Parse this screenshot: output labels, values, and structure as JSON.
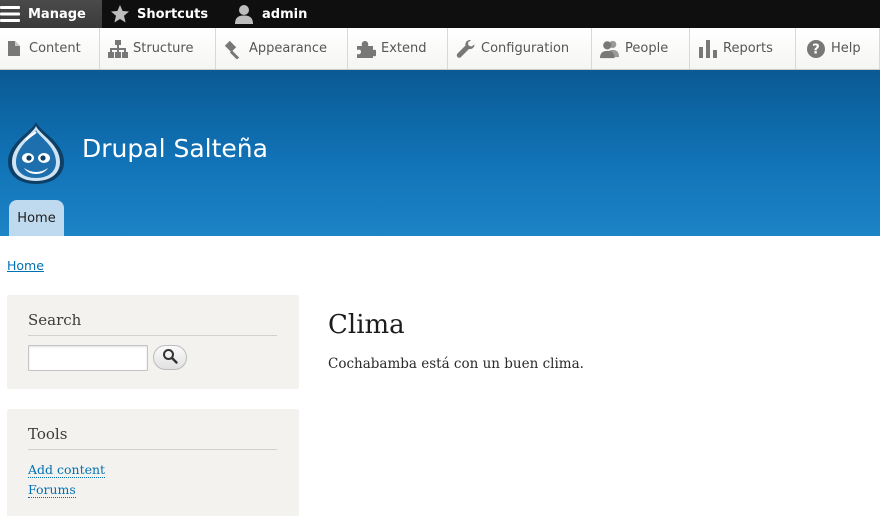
{
  "toolbar": {
    "manage": "Manage",
    "shortcuts": "Shortcuts",
    "user": "admin"
  },
  "tray": {
    "items": [
      {
        "label": "Content",
        "icon": "file-icon"
      },
      {
        "label": "Structure",
        "icon": "sitemap-icon"
      },
      {
        "label": "Appearance",
        "icon": "paintbrush-icon"
      },
      {
        "label": "Extend",
        "icon": "puzzle-icon"
      },
      {
        "label": "Configuration",
        "icon": "wrench-icon"
      },
      {
        "label": "People",
        "icon": "people-icon"
      },
      {
        "label": "Reports",
        "icon": "bar-chart-icon"
      },
      {
        "label": "Help",
        "icon": "help-icon"
      }
    ]
  },
  "header": {
    "site_name": "Drupal Salteña",
    "tab_home": "Home"
  },
  "breadcrumb": {
    "home": "Home"
  },
  "sidebar": {
    "search_title": "Search",
    "tools_title": "Tools",
    "tools_links": [
      "Add content",
      "Forums"
    ]
  },
  "main": {
    "title": "Clima",
    "body": "Cochabamba está con un buen clima."
  },
  "colors": {
    "header_top": "#0a5a93",
    "header_bottom": "#1d84c6",
    "link": "#0071b3",
    "sidebar_bg": "#f3f2ee",
    "toolbar_bg": "#0f0f0f"
  }
}
